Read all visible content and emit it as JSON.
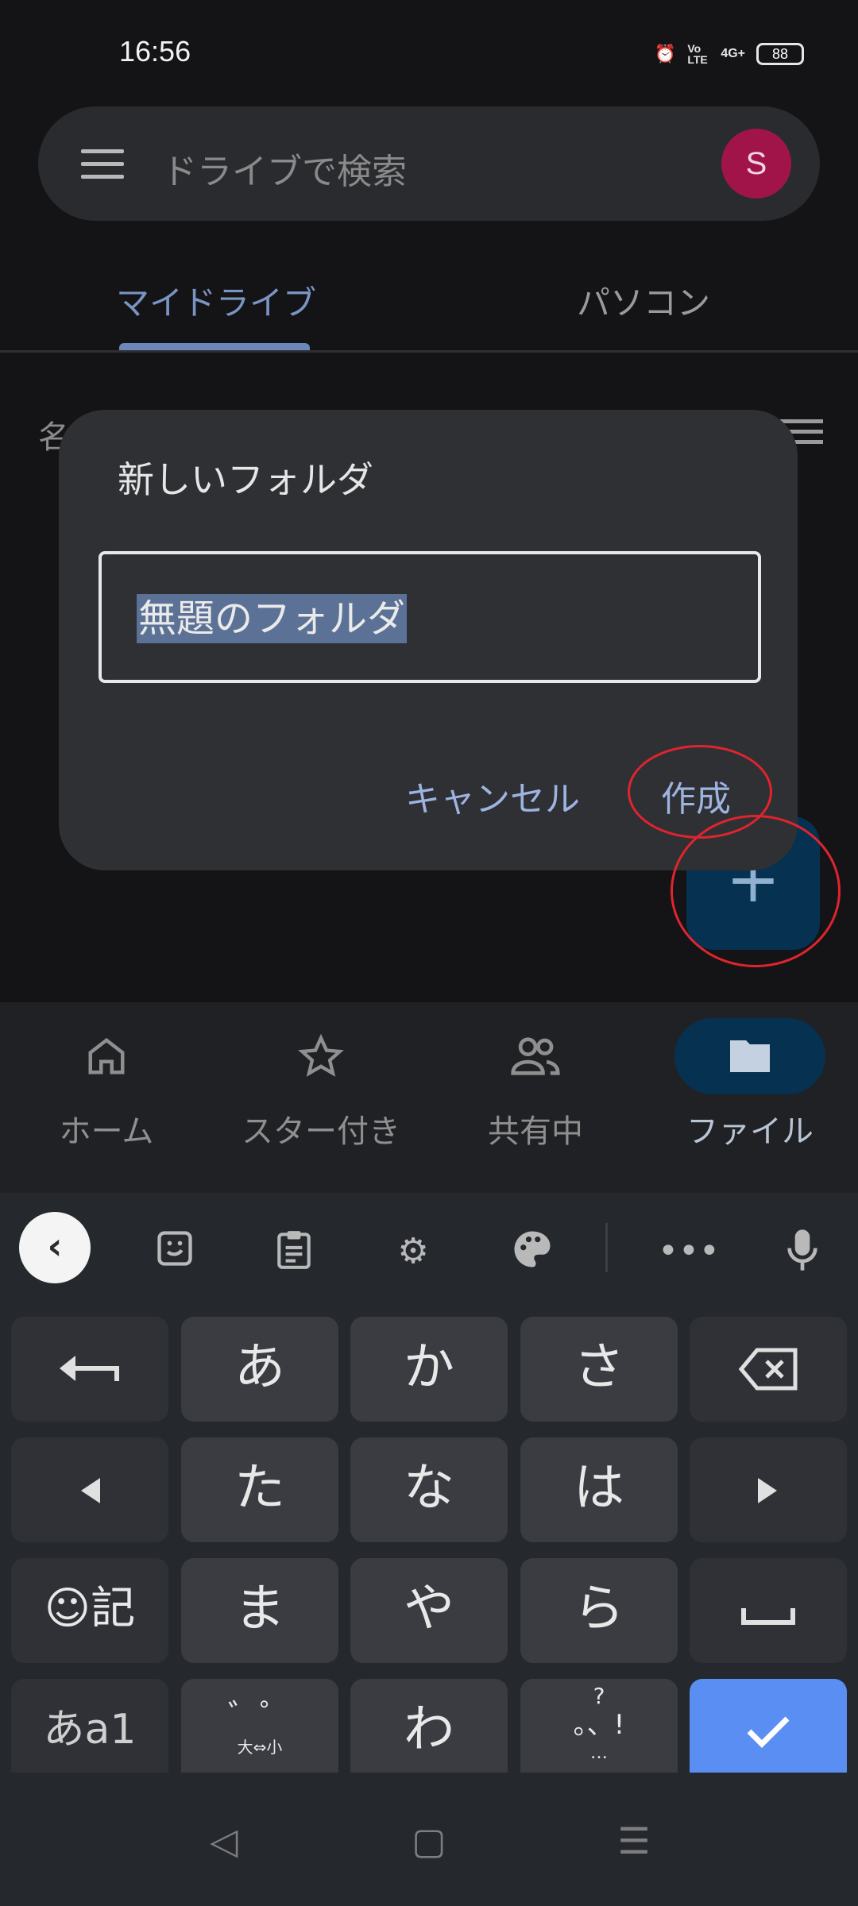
{
  "status": {
    "time": "16:56",
    "battery": "88",
    "volte": "Vo LTE",
    "network": "4G+"
  },
  "search": {
    "placeholder": "ドライブで検索",
    "avatar_letter": "S"
  },
  "tabs": [
    {
      "label": "マイドライブ"
    },
    {
      "label": "パソコン"
    }
  ],
  "list": {
    "sort_label_partial": "名前"
  },
  "dialog": {
    "title": "新しいフォルダ",
    "field_value": "無題のフォルダ",
    "cancel_label": "キャンセル",
    "create_label": "作成"
  },
  "bottom_nav": [
    {
      "label": "ホーム",
      "icon": "home-icon"
    },
    {
      "label": "スター付き",
      "icon": "star-icon"
    },
    {
      "label": "共有中",
      "icon": "people-icon"
    },
    {
      "label": "ファイル",
      "icon": "folder-icon"
    }
  ],
  "keyboard": {
    "row1": [
      "あ",
      "か",
      "さ"
    ],
    "row2": [
      "た",
      "な",
      "は"
    ],
    "row3": [
      "ま",
      "や",
      "ら"
    ],
    "row4_mid": "わ",
    "emoji_key": "記",
    "mode_key": "あa1",
    "dakuten_top": "゛゜",
    "dakuten_bottom": "大⇔小",
    "punct_top": "?",
    "punct_mid": "。、!",
    "punct_bottom": "…"
  },
  "colors": {
    "accent": "#9db3e0",
    "enter_key": "#5b8ef2",
    "avatar": "#a0144a",
    "annotation": "#e0242e"
  }
}
